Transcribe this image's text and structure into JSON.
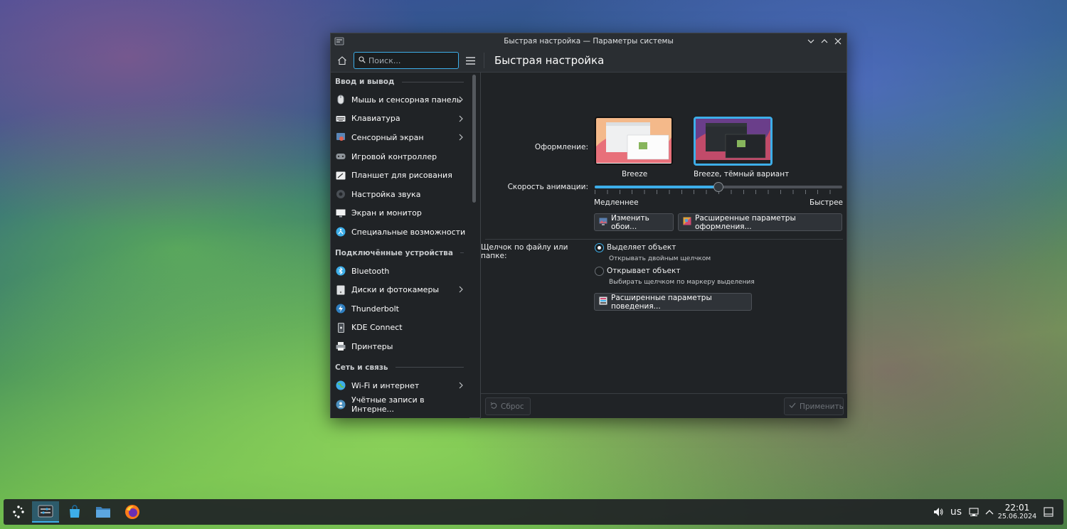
{
  "window": {
    "title": "Быстрая настройка — Параметры системы",
    "page_title": "Быстрая настройка"
  },
  "search": {
    "placeholder": "Поиск...",
    "value": ""
  },
  "sidebar": {
    "sections": [
      {
        "header": "Ввод и вывод",
        "items": [
          {
            "label": "Мышь и сенсорная панель",
            "icon": "mouse-icon",
            "chevron": true
          },
          {
            "label": "Клавиатура",
            "icon": "keyboard-icon",
            "chevron": true
          },
          {
            "label": "Сенсорный экран",
            "icon": "touchscreen-icon",
            "chevron": true
          },
          {
            "label": "Игровой контроллер",
            "icon": "gamepad-icon",
            "chevron": false
          },
          {
            "label": "Планшет для рисования",
            "icon": "tablet-icon",
            "chevron": false
          },
          {
            "label": "Настройка звука",
            "icon": "audio-icon",
            "chevron": false
          },
          {
            "label": "Экран и монитор",
            "icon": "monitor-icon",
            "chevron": false
          },
          {
            "label": "Специальные возможности",
            "icon": "accessibility-icon",
            "chevron": false
          }
        ]
      },
      {
        "header": "Подключённые устройства",
        "items": [
          {
            "label": "Bluetooth",
            "icon": "bluetooth-icon",
            "chevron": false
          },
          {
            "label": "Диски и фотокамеры",
            "icon": "drive-icon",
            "chevron": true
          },
          {
            "label": "Thunderbolt",
            "icon": "thunderbolt-icon",
            "chevron": false
          },
          {
            "label": "KDE Connect",
            "icon": "phone-icon",
            "chevron": false
          },
          {
            "label": "Принтеры",
            "icon": "printer-icon",
            "chevron": false
          }
        ]
      },
      {
        "header": "Сеть и связь",
        "items": [
          {
            "label": "Wi-Fi и интернет",
            "icon": "globe-icon",
            "chevron": true
          },
          {
            "label": "Учётные записи в Интерне...",
            "icon": "online-accounts-icon",
            "chevron": false
          }
        ]
      }
    ]
  },
  "appearance": {
    "label": "Оформление:",
    "themes": [
      {
        "name": "Breeze",
        "selected": false
      },
      {
        "name": "Breeze, тёмный вариант",
        "selected": true
      }
    ]
  },
  "animation": {
    "label": "Скорость анимации:",
    "slow": "Медленнее",
    "fast": "Быстрее",
    "value_fraction": 0.5
  },
  "buttons": {
    "wallpaper": "Изменить обои...",
    "advanced_appearance": "Расширенные параметры оформления...",
    "advanced_behavior": "Расширенные параметры поведения...",
    "reset": "Сброс",
    "apply": "Применить"
  },
  "click": {
    "label": "Щелчок по файлу или папке:",
    "options": [
      {
        "title": "Выделяет объект",
        "hint": "Открывать двойным щелчком",
        "selected": true
      },
      {
        "title": "Открывает объект",
        "hint": "Выбирать щелчком по маркеру выделения",
        "selected": false
      }
    ]
  },
  "tray": {
    "layout": "us",
    "time": "22:01",
    "date": "25.06.2024"
  },
  "colors": {
    "accent": "#3daee9",
    "window_bg": "#202326"
  }
}
